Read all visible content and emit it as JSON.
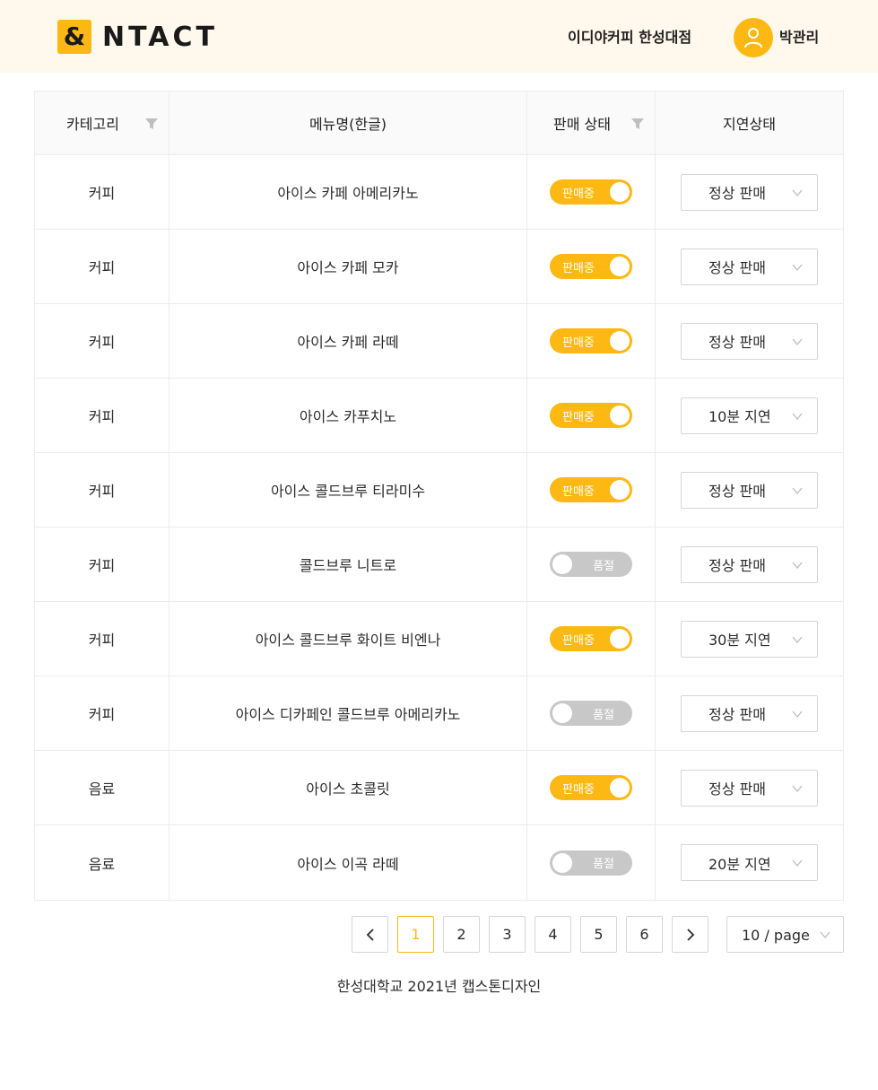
{
  "header": {
    "logo_mark": "&",
    "logo_text": "NTACT",
    "store_name": "이디야커피 한성대점",
    "user_name": "박관리"
  },
  "table": {
    "columns": [
      "카테고리",
      "메뉴명(한글)",
      "판매 상태",
      "지연상태"
    ],
    "rows": [
      {
        "category": "커피",
        "menu": "아이스 카페 아메리카노",
        "sale_on": true,
        "sale_label": "판매중",
        "delay": "정상 판매"
      },
      {
        "category": "커피",
        "menu": "아이스 카페 모카",
        "sale_on": true,
        "sale_label": "판매중",
        "delay": "정상 판매"
      },
      {
        "category": "커피",
        "menu": "아이스 카페 라떼",
        "sale_on": true,
        "sale_label": "판매중",
        "delay": "정상 판매"
      },
      {
        "category": "커피",
        "menu": "아이스 카푸치노",
        "sale_on": true,
        "sale_label": "판매중",
        "delay": "10분 지연"
      },
      {
        "category": "커피",
        "menu": "아이스 콜드브루 티라미수",
        "sale_on": true,
        "sale_label": "판매중",
        "delay": "정상 판매"
      },
      {
        "category": "커피",
        "menu": "콜드브루 니트로",
        "sale_on": false,
        "sale_label": "품절",
        "delay": "정상 판매"
      },
      {
        "category": "커피",
        "menu": "아이스 콜드브루 화이트 비엔나",
        "sale_on": true,
        "sale_label": "판매중",
        "delay": "30분 지연"
      },
      {
        "category": "커피",
        "menu": "아이스 디카페인 콜드브루 아메리카노",
        "sale_on": false,
        "sale_label": "품절",
        "delay": "정상 판매"
      },
      {
        "category": "음료",
        "menu": "아이스 초콜릿",
        "sale_on": true,
        "sale_label": "판매중",
        "delay": "정상 판매"
      },
      {
        "category": "음료",
        "menu": "아이스 이곡 라떼",
        "sale_on": false,
        "sale_label": "품절",
        "delay": "20분 지연"
      }
    ]
  },
  "pagination": {
    "prev": "<",
    "next": ">",
    "pages": [
      "1",
      "2",
      "3",
      "4",
      "5",
      "6"
    ],
    "current": "1",
    "page_size": "10 / page"
  },
  "footer": {
    "text": "한성대학교 2021년 캡스톤디자인"
  },
  "colors": {
    "accent": "#fdb813",
    "header_bg": "#fff8ec",
    "toggle_off": "#c8c8c8"
  },
  "icons": {
    "user": "user-icon",
    "filter": "filter-icon",
    "chevron": "chevron-down-icon"
  }
}
